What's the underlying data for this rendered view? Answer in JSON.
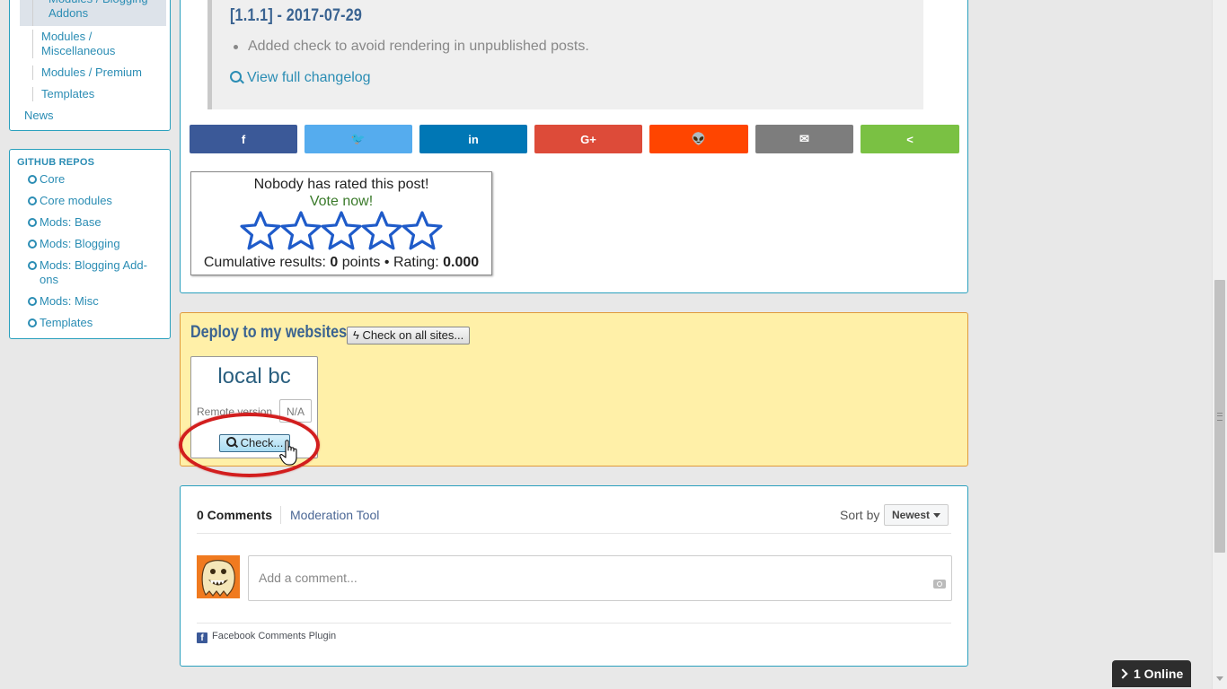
{
  "sidebar": {
    "nav_items": [
      "Modules / Blogging Addons",
      "Modules / Miscellaneous",
      "Modules / Premium",
      "Templates"
    ],
    "news_label": "News",
    "repos_title": "GITHUB REPOS",
    "repos": [
      "Core",
      "Core modules",
      "Mods: Base",
      "Mods: Blogging",
      "Mods: Blogging Add-ons",
      "Mods: Misc",
      "Templates"
    ]
  },
  "changelog": {
    "version": "[1.1.1] - 2017-07-29",
    "entry": "Added check to avoid rendering in unpublished posts.",
    "view_full_label": "View full changelog"
  },
  "share": {
    "buttons": [
      {
        "name": "facebook",
        "glyph": "f",
        "color": "#3b5998"
      },
      {
        "name": "twitter",
        "glyph": "🐦",
        "color": "#55acee"
      },
      {
        "name": "linkedin",
        "glyph": "in",
        "color": "#0077b5"
      },
      {
        "name": "google-plus",
        "glyph": "G+",
        "color": "#dd4b39"
      },
      {
        "name": "reddit",
        "glyph": "👽",
        "color": "#ff4500"
      },
      {
        "name": "email",
        "glyph": "✉",
        "color": "#7d7d7d"
      },
      {
        "name": "share",
        "glyph": "<",
        "color": "#7ac143"
      }
    ]
  },
  "rating": {
    "title": "Nobody has rated this post!",
    "vote_label": "Vote now!",
    "results_prefix": "Cumulative results:",
    "points_value": "0",
    "points_label": "points",
    "separator": "•",
    "rating_label": "Rating:",
    "rating_value": "0.000",
    "stars_filled": 0,
    "stars_total": 5
  },
  "deploy": {
    "title": "Deploy to my websites",
    "check_all_label": "Check on all sites...",
    "site_name": "local bc",
    "remote_version_label": "Remote version",
    "remote_version_value": "N/A",
    "check_label": "Check..."
  },
  "comments": {
    "count_label": "0 Comments",
    "moderation_label": "Moderation Tool",
    "sort_label": "Sort by",
    "sort_value": "Newest",
    "input_placeholder": "Add a comment...",
    "plugin_label": "Facebook Comments Plugin"
  },
  "online_widget": {
    "label": "1 Online"
  }
}
